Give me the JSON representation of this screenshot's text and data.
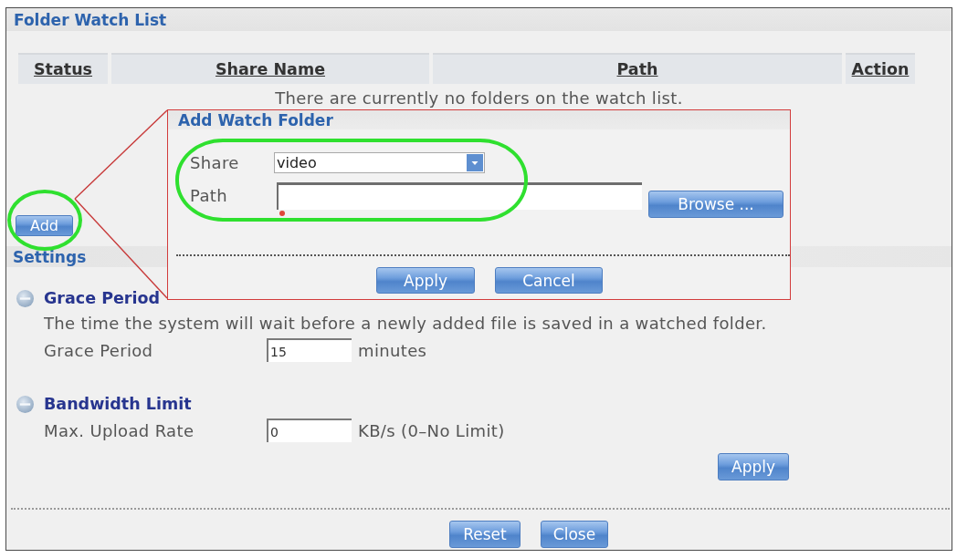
{
  "panel": {
    "title": "Folder Watch List"
  },
  "table": {
    "columns": [
      "Status",
      "Share Name",
      "Path",
      "Action"
    ],
    "empty_message": "There are currently no folders on the watch list."
  },
  "add_button": {
    "label": "Add",
    "highlighted": true
  },
  "callout": {
    "title": "Add Watch Folder",
    "fields_highlighted": true,
    "fields": [
      {
        "kind": "select",
        "label": "Share",
        "value": "video"
      },
      {
        "kind": "text",
        "label": "Path",
        "required": true,
        "button": "Browse ..."
      }
    ],
    "buttons": [
      "Apply",
      "Cancel"
    ]
  },
  "settings": {
    "title": "Settings",
    "sections": [
      {
        "title": "Grace Period",
        "expanded": true,
        "description": "The time the system will wait before a newly added file is saved in a watched folder.",
        "fields": [
          {
            "label": "Grace Period",
            "value": "15",
            "unit": "minutes"
          }
        ]
      },
      {
        "title": "Bandwidth Limit",
        "expanded": true,
        "fields": [
          {
            "label": "Max. Upload Rate",
            "value": "0",
            "unit": "KB/s (0–No Limit)"
          }
        ]
      }
    ],
    "apply": "Apply"
  },
  "footer_buttons": [
    "Reset",
    "Close"
  ]
}
